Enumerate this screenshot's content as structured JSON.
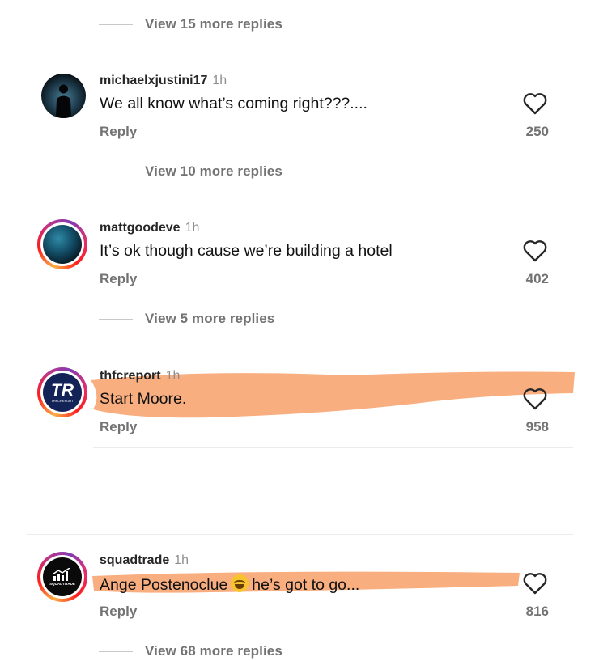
{
  "threads": [
    {
      "view_more": "View 15 more replies"
    },
    {
      "username": "michaelxjustini17",
      "time": "1h",
      "text": "We all know what’s coming right???....",
      "reply": "Reply",
      "likes": "250",
      "view_more": "View 10 more replies"
    },
    {
      "username": "mattgoodeve",
      "time": "1h",
      "text": "It’s ok though cause we’re building a hotel",
      "reply": "Reply",
      "likes": "402",
      "view_more": "View 5 more replies"
    },
    {
      "username": "thfcreport",
      "time": "1h",
      "text": "Start Moore.",
      "reply": "Reply",
      "likes": "958",
      "avatar_text": "TR",
      "avatar_subtext": "THFCREPORT"
    },
    {
      "username": "squadtrade",
      "time": "1h",
      "text_before_emoji": "Ange Postenoclue",
      "emoji": "laughing-crying-emoji",
      "text_after_emoji": "he’s got to go...",
      "reply": "Reply",
      "likes": "816",
      "avatar_text": "SQUADTRADE",
      "view_more": "View 68 more replies"
    }
  ],
  "colors": {
    "highlight": "#f8a06a",
    "secondary_text": "#737373",
    "thfc_navy": "#132257"
  },
  "icons": {
    "like": "heart-outline-icon"
  }
}
